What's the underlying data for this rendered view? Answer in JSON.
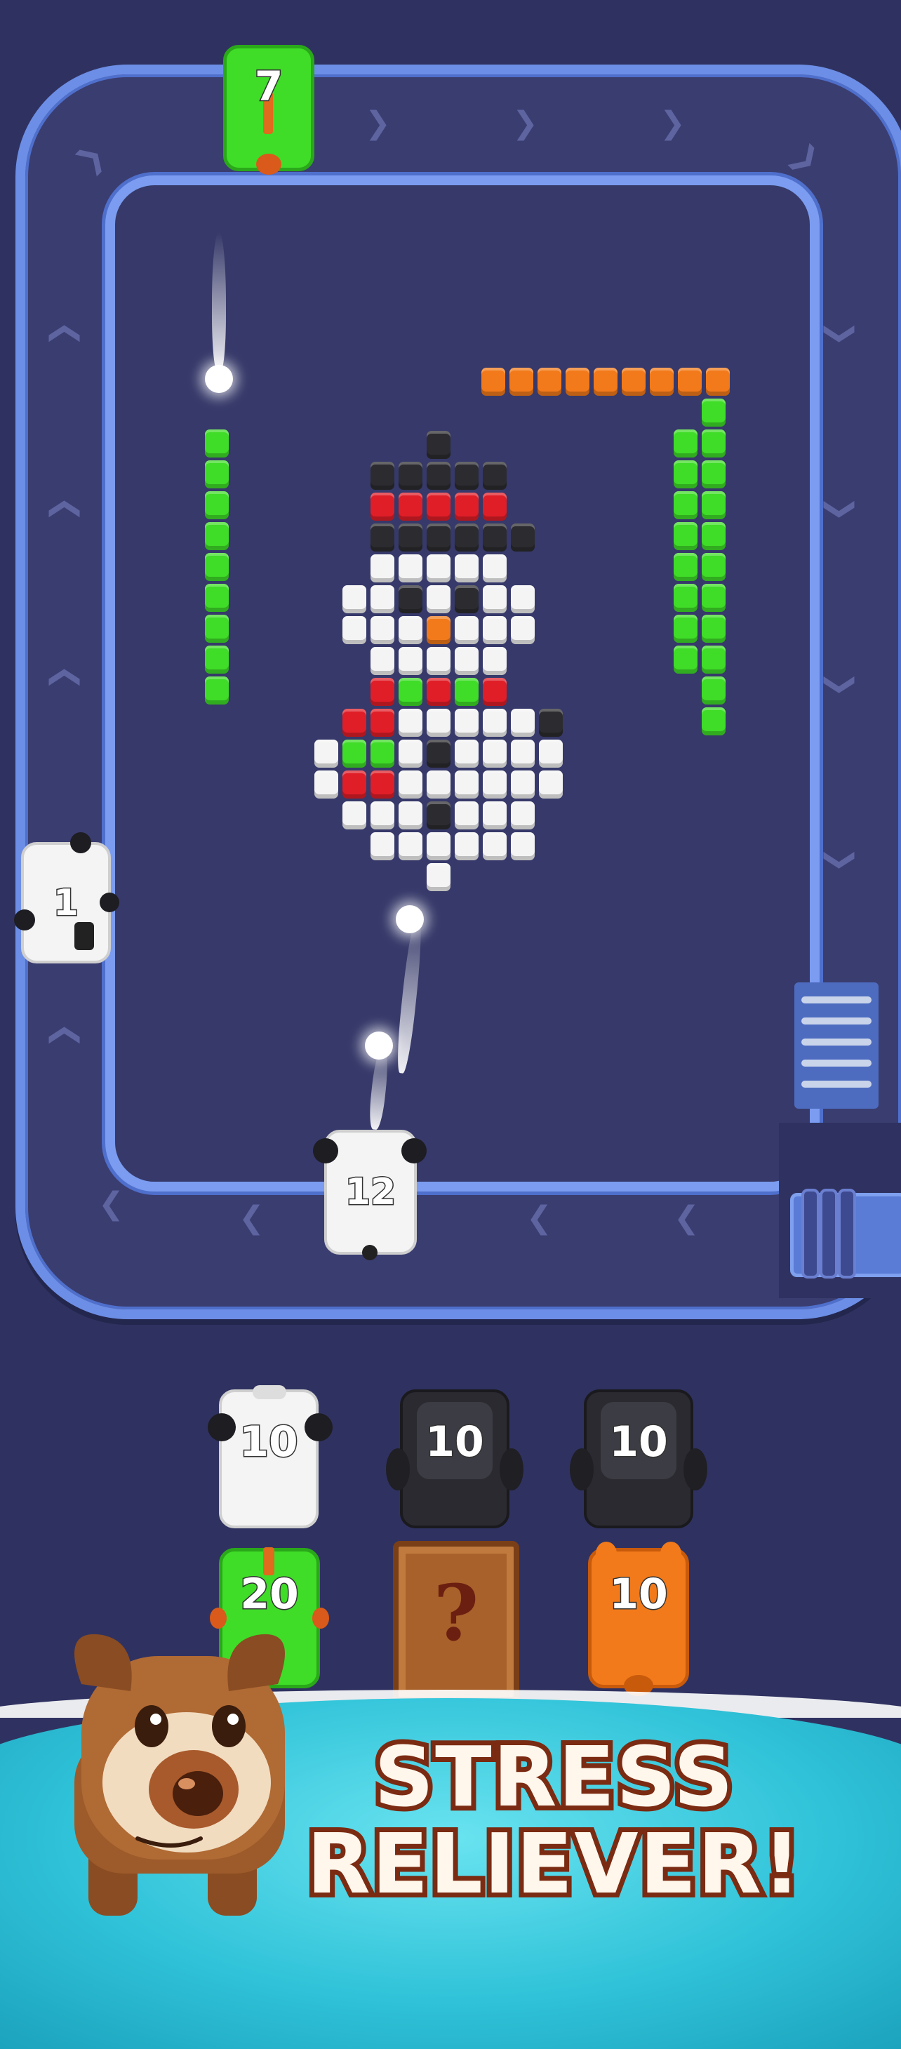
{
  "track": {
    "shooters": [
      {
        "id": "top",
        "number": "7",
        "color": "#3fdc28",
        "accent": "#e06a1d"
      },
      {
        "id": "left",
        "number": "1",
        "color": "#f4f4f4",
        "accent": "#1b1b1b"
      },
      {
        "id": "bottom",
        "number": "12",
        "color": "#f4f4f4",
        "accent": "#1b1b1b"
      }
    ]
  },
  "queue": {
    "column1": [
      {
        "number": "10",
        "color": "#f4f4f4",
        "type": "panda"
      },
      {
        "number": "20",
        "color": "#3fdc28",
        "type": "frog"
      }
    ],
    "column2": [
      {
        "number": "10",
        "color": "#2a2a30",
        "type": "penguin"
      },
      {
        "number": "?",
        "color": "#a8612b",
        "type": "mystery-crate"
      }
    ],
    "column3": [
      {
        "number": "10",
        "color": "#2a2a30",
        "type": "penguin"
      },
      {
        "number": "10",
        "color": "#f27a1a",
        "type": "fox"
      }
    ]
  },
  "banner": {
    "line1": "STRESS",
    "line2": "RELIEVER!"
  },
  "palette": {
    "background": "#2f3260",
    "track": "#6c8ee6",
    "green": "#3fdc28",
    "orange": "#f27a1a",
    "red": "#e01e28",
    "black": "#2c2c30",
    "white": "#f4f4f4"
  }
}
